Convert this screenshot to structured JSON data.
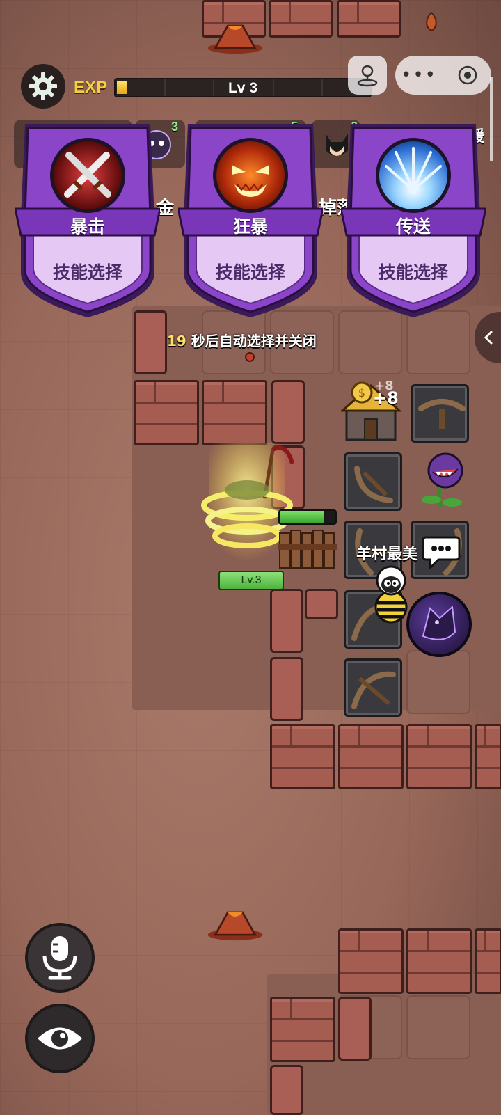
{
  "hud": {
    "exp_label": "EXP",
    "level_text": "Lv 3",
    "exp_progress": 0.03
  },
  "slots": {
    "numbers": [
      "3",
      "5",
      "6"
    ],
    "support_partial": "支援",
    "gold_partial": "金",
    "drop_partial": "掉落"
  },
  "skill_cards": [
    {
      "name": "暴击",
      "action": "技能选择",
      "icon": "crossed-swords-icon"
    },
    {
      "name": "狂暴",
      "action": "技能选择",
      "icon": "rage-face-icon"
    },
    {
      "name": "传送",
      "action": "技能选择",
      "icon": "teleport-burst-icon"
    }
  ],
  "countdown": {
    "seconds": "19",
    "text": "秒后自动选择并关闭"
  },
  "player": {
    "level_badge": "Lv.3"
  },
  "npc": {
    "chat_name": "羊村最美"
  },
  "pickup": {
    "amount": "+8"
  },
  "colors": {
    "card_purple": "#8a45c8",
    "card_light": "#e6c8f4",
    "exp_yellow": "#f4d03f",
    "hp_green": "#56c044"
  }
}
